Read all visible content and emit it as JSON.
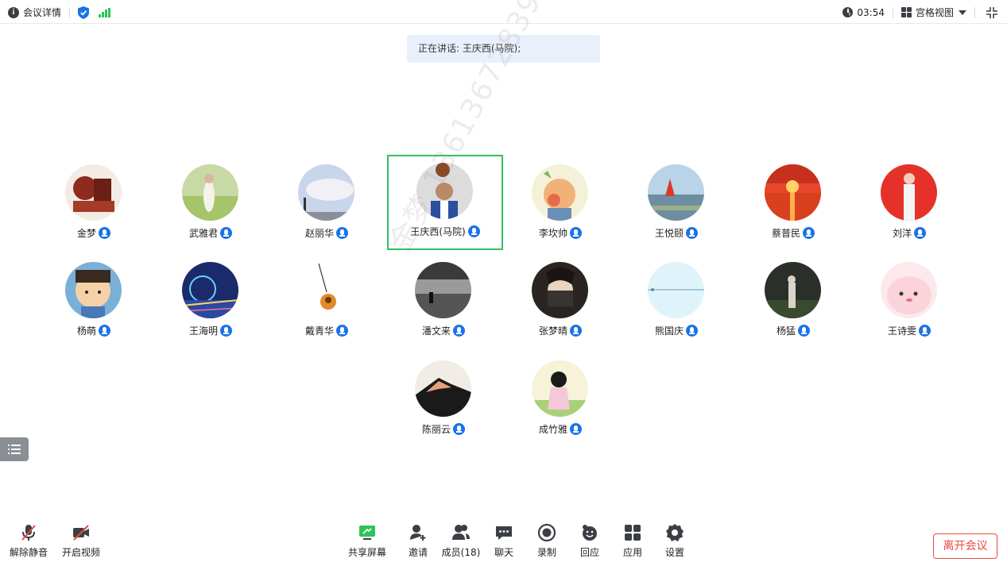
{
  "topbar": {
    "meeting_details": "会议详情",
    "timer": "03:54",
    "view_mode": "宫格视图"
  },
  "speaking": "正在讲话: 王庆西(马院);",
  "watermark": "金梦 13613672839",
  "participants": [
    {
      "name": "金梦",
      "active": false
    },
    {
      "name": "武雅君",
      "active": false
    },
    {
      "name": "赵丽华",
      "active": false
    },
    {
      "name": "王庆西(马院)",
      "active": true
    },
    {
      "name": "李坎帅",
      "active": false
    },
    {
      "name": "王悦颐",
      "active": false
    },
    {
      "name": "蔡普民",
      "active": false
    },
    {
      "name": "刘洋",
      "active": false
    },
    {
      "name": "杨萌",
      "active": false
    },
    {
      "name": "王海明",
      "active": false
    },
    {
      "name": "戴青华",
      "active": false
    },
    {
      "name": "潘文来",
      "active": false
    },
    {
      "name": "张梦晴",
      "active": false
    },
    {
      "name": "熊国庆",
      "active": false
    },
    {
      "name": "杨猛",
      "active": false
    },
    {
      "name": "王诗雯",
      "active": false
    },
    {
      "name": "陈丽云",
      "active": false
    },
    {
      "name": "成竹雅",
      "active": false
    }
  ],
  "toolbar": {
    "unmute": "解除静音",
    "start_video": "开启视频",
    "share_screen": "共享屏幕",
    "invite": "邀请",
    "members": "成员(18)",
    "chat": "聊天",
    "record": "录制",
    "replay": "回应",
    "apps": "应用",
    "settings": "设置",
    "leave": "离开会议"
  },
  "colors": {
    "active_border": "#2fc25b",
    "mic_badge": "#1a73e8",
    "leave_red": "#e84a40",
    "banner_bg": "#eaf0fb"
  }
}
